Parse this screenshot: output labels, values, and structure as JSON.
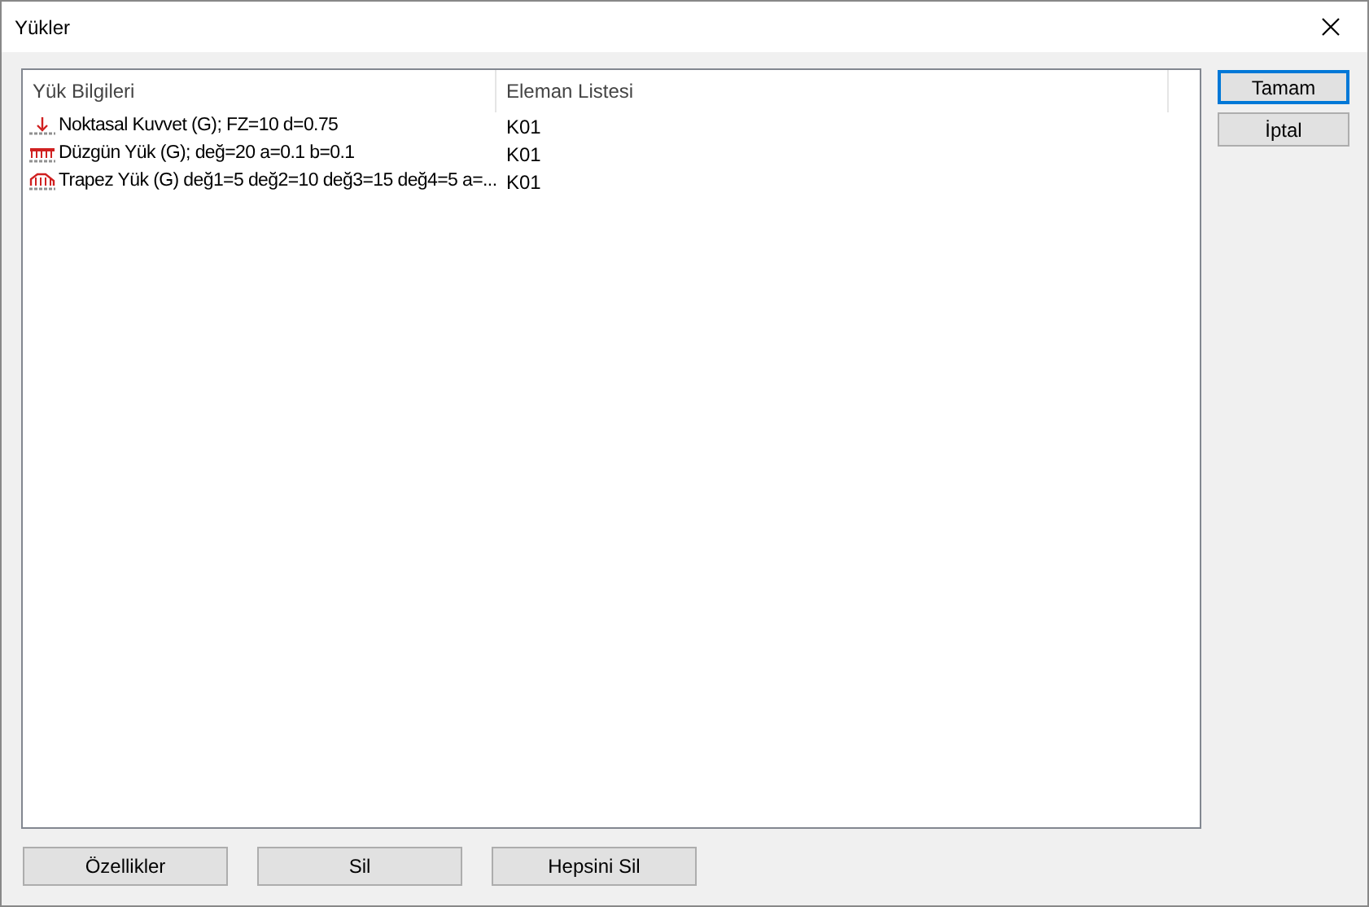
{
  "window": {
    "title": "Yükler"
  },
  "table": {
    "columns": [
      "Yük Bilgileri",
      "Eleman Listesi"
    ],
    "rows": [
      {
        "kind": "point",
        "info": "Noktasal Kuvvet (G); FZ=10 d=0.75",
        "elements": "K01"
      },
      {
        "kind": "uniform",
        "info": "Düzgün Yük (G); değ=20 a=0.1 b=0.1",
        "elements": "K01"
      },
      {
        "kind": "trapezoid",
        "info": "Trapez Yük (G) değ1=5 değ2=10 değ3=15 değ4=5 a=...",
        "elements": "K01"
      }
    ]
  },
  "side_buttons": [
    {
      "label": "Tamam",
      "default": true
    },
    {
      "label": "İptal",
      "default": false
    }
  ],
  "bottom_buttons": [
    "Özellikler",
    "Sil",
    "Hepsini Sil"
  ]
}
